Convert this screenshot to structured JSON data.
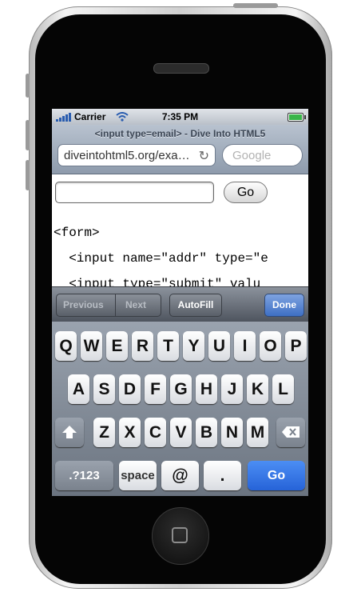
{
  "status_bar": {
    "carrier": "Carrier",
    "time": "7:35 PM"
  },
  "browser": {
    "title": "<input type=email> - Dive Into HTML5",
    "url": "diveintohtml5.org/exa…",
    "search_placeholder": "Google"
  },
  "page": {
    "go_label": "Go",
    "code_lines": [
      "<form>",
      "  <input name=\"addr\" type=\"e",
      "  <input type=\"submit\" valu"
    ]
  },
  "form_toolbar": {
    "previous": "Previous",
    "next": "Next",
    "autofill": "AutoFill",
    "done": "Done"
  },
  "keyboard": {
    "row1": [
      "Q",
      "W",
      "E",
      "R",
      "T",
      "Y",
      "U",
      "I",
      "O",
      "P"
    ],
    "row2": [
      "A",
      "S",
      "D",
      "F",
      "G",
      "H",
      "J",
      "K",
      "L"
    ],
    "row3": [
      "Z",
      "X",
      "C",
      "V",
      "B",
      "N",
      "M"
    ],
    "numbers_key": ".?123",
    "space_key": "space",
    "at_key": "@",
    "dot_key": ".",
    "go_key": "Go"
  },
  "colors": {
    "go_key": "#2663d8",
    "done": "#3e6fc4",
    "battery": "#39b54a"
  }
}
